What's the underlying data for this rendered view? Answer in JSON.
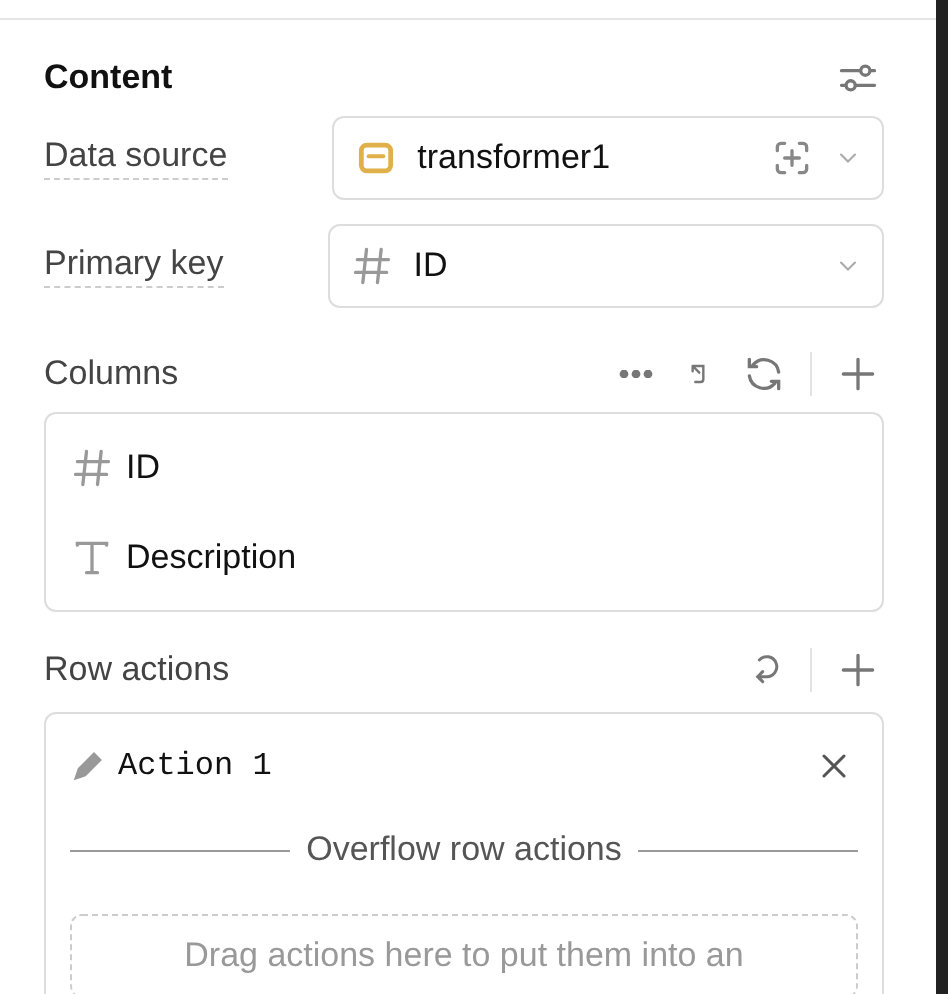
{
  "section": {
    "title": "Content"
  },
  "fields": [
    {
      "label": "Data source",
      "kind": "source",
      "value": "transformer1"
    },
    {
      "label": "Primary key",
      "kind": "number",
      "value": "ID"
    }
  ],
  "columns": {
    "title": "Columns",
    "items": [
      {
        "kind": "number",
        "name": "ID"
      },
      {
        "kind": "text",
        "name": "Description"
      }
    ]
  },
  "row_actions": {
    "title": "Row actions",
    "items": [
      {
        "name": "Action 1"
      }
    ],
    "divider_label": "Overflow row actions",
    "drop_hint": "Drag actions here to put them into an"
  }
}
